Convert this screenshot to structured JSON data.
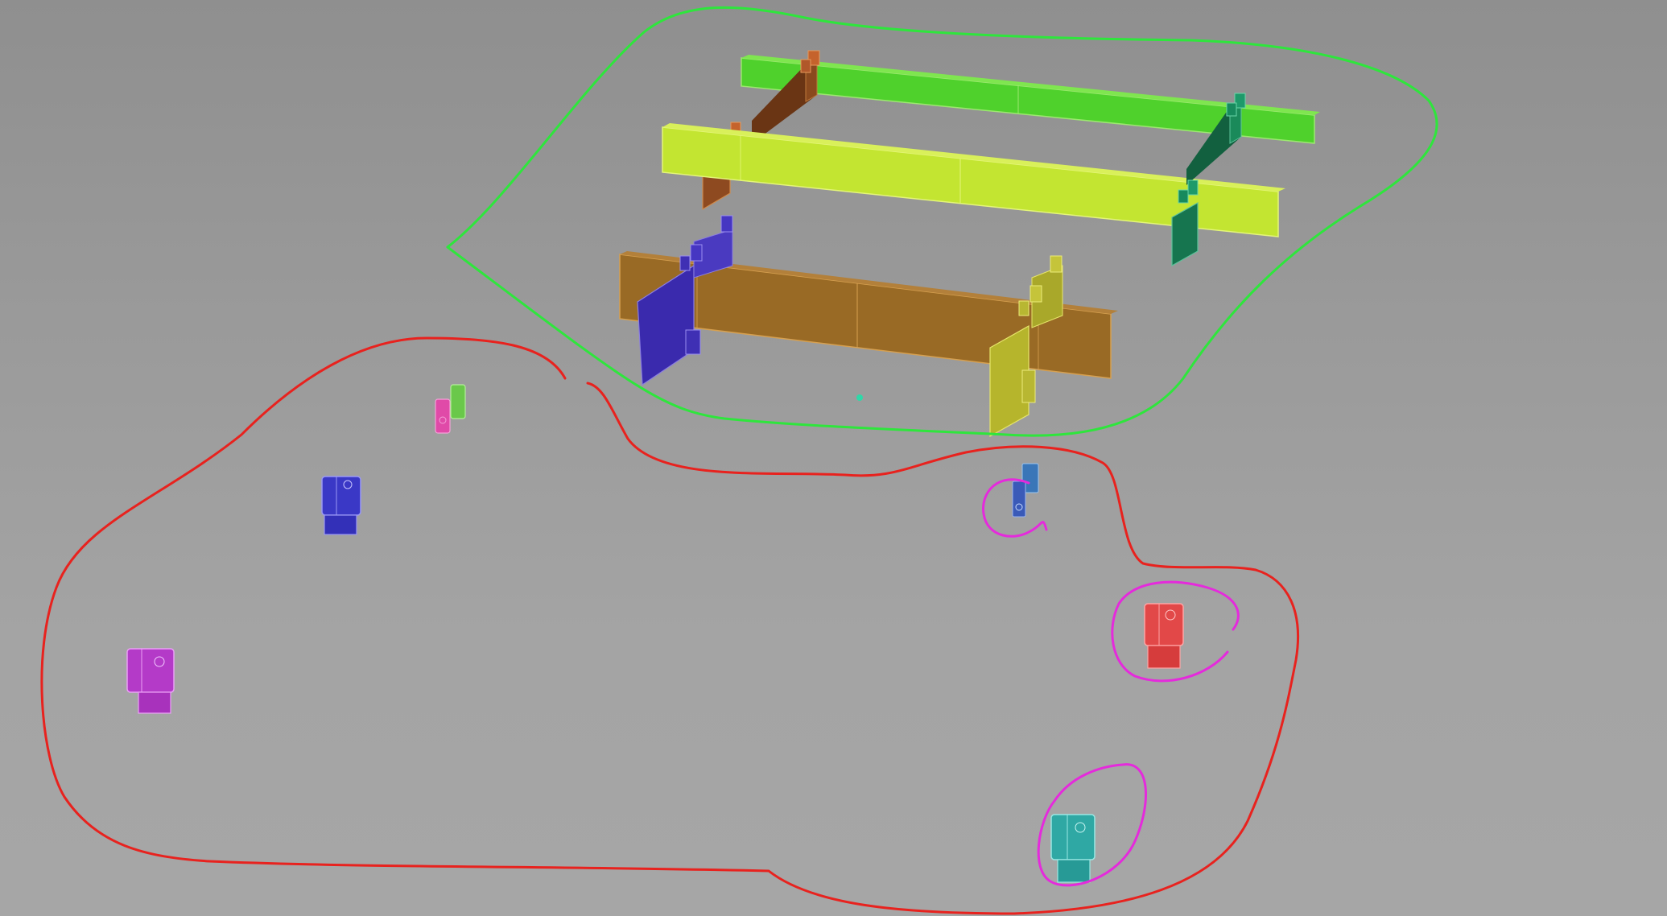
{
  "viewport": {
    "background": "#9c9c9c"
  },
  "colors": {
    "beam_green": "#4fd12c",
    "beam_yellow_green": "#c3e531",
    "beam_orange": "#996a25",
    "brace_brown": "#7a3d18",
    "brace_dark_green": "#16754f",
    "plate_blue": "#3a2aad",
    "plate_yellow": "#b6b52c",
    "annotation_green": "#2ee63c",
    "annotation_red": "#e8221e",
    "annotation_magenta": "#e52adc"
  },
  "annotations": [
    {
      "name": "annotation-green-loop",
      "color": "#2ee63c"
    },
    {
      "name": "annotation-red-loop",
      "color": "#e8221e"
    },
    {
      "name": "annotation-magenta-small-loop",
      "color": "#e52adc"
    },
    {
      "name": "annotation-magenta-red-part-loop",
      "color": "#e52adc"
    },
    {
      "name": "annotation-magenta-teal-part-loop",
      "color": "#e52adc"
    }
  ],
  "parts": [
    {
      "name": "part-magenta-clip",
      "color": "#b43ac8"
    },
    {
      "name": "part-blue-clip",
      "color": "#3a38c6"
    },
    {
      "name": "part-pink-green-pair",
      "color": "#e04aa8"
    },
    {
      "name": "part-blue-teal-small",
      "color": "#3a76b8"
    },
    {
      "name": "part-red-clip",
      "color": "#e24848"
    },
    {
      "name": "part-teal-clip",
      "color": "#2fa8a4"
    }
  ]
}
